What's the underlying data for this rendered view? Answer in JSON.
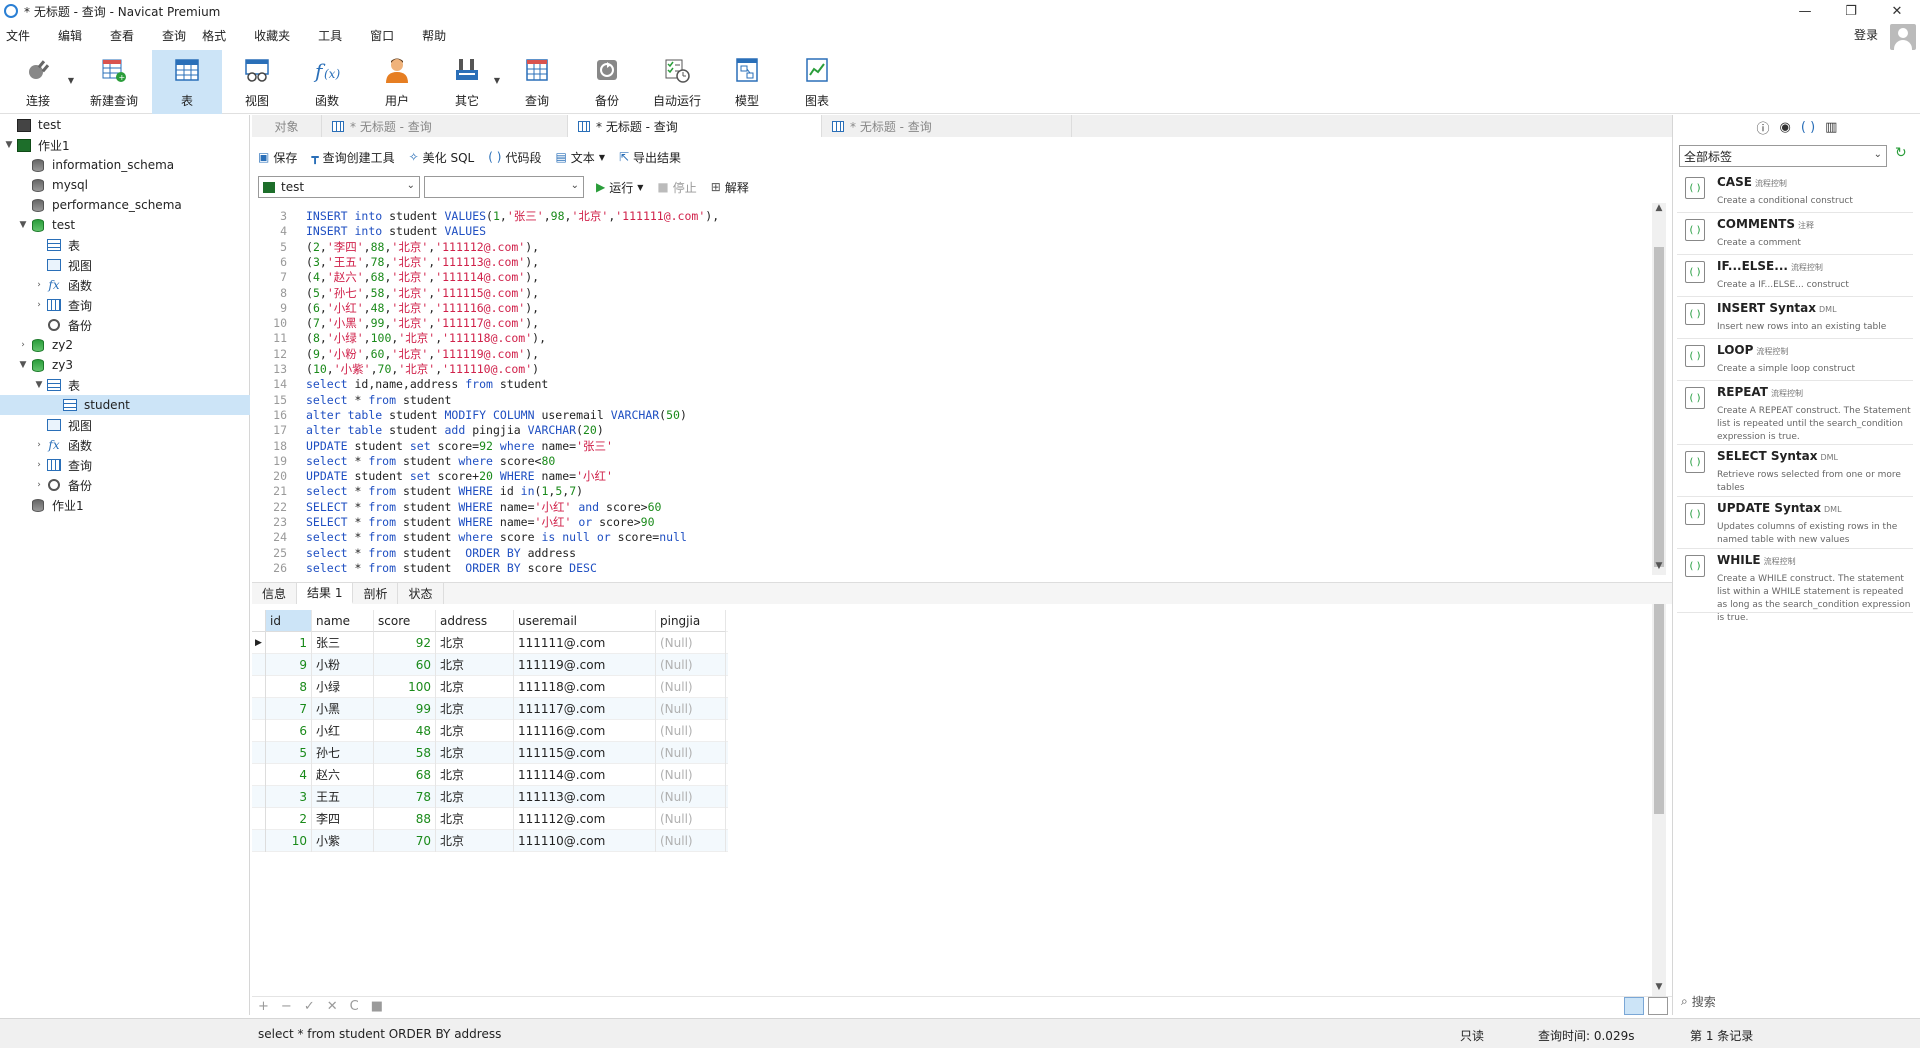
{
  "window": {
    "title": "* 无标题 - 查询 - Navicat Premium",
    "buttons": [
      "—",
      "❐",
      "✕"
    ]
  },
  "menu": {
    "items": [
      "文件",
      "编辑",
      "查看",
      "查询",
      "格式",
      "收藏夹",
      "工具",
      "窗口",
      "帮助"
    ],
    "login": "登录"
  },
  "toolbar": {
    "buttons": [
      {
        "label": "连接",
        "icon": "plug-icon"
      },
      {
        "label": "新建查询",
        "icon": "new-query-icon"
      },
      {
        "label": "表",
        "icon": "table-icon"
      },
      {
        "label": "视图",
        "icon": "view-icon"
      },
      {
        "label": "函数",
        "icon": "function-icon"
      },
      {
        "label": "用户",
        "icon": "user-icon"
      },
      {
        "label": "其它",
        "icon": "tools-icon"
      },
      {
        "label": "查询",
        "icon": "query-icon"
      },
      {
        "label": "备份",
        "icon": "backup-icon"
      },
      {
        "label": "自动运行",
        "icon": "schedule-icon"
      },
      {
        "label": "模型",
        "icon": "model-icon"
      },
      {
        "label": "图表",
        "icon": "chart-icon"
      }
    ]
  },
  "tree": {
    "items": [
      {
        "label": "test"
      },
      {
        "label": "作业1"
      },
      {
        "label": "information_schema"
      },
      {
        "label": "mysql"
      },
      {
        "label": "performance_schema"
      },
      {
        "label": "test"
      },
      {
        "label": "表"
      },
      {
        "label": "视图"
      },
      {
        "label": "函数"
      },
      {
        "label": "查询"
      },
      {
        "label": "备份"
      },
      {
        "label": "zy2"
      },
      {
        "label": "zy3"
      },
      {
        "label": "表"
      },
      {
        "label": "student"
      },
      {
        "label": "视图"
      },
      {
        "label": "函数"
      },
      {
        "label": "查询"
      },
      {
        "label": "备份"
      },
      {
        "label": "作业1"
      }
    ]
  },
  "tabs": [
    {
      "label": "对象"
    },
    {
      "label": "* 无标题 - 查询"
    },
    {
      "label": "* 无标题 - 查询"
    },
    {
      "label": "* 无标题 - 查询"
    }
  ],
  "query_toolbar": {
    "save": "保存",
    "builder": "查询创建工具",
    "beautify": "美化 SQL",
    "snippet": "代码段",
    "text": "文本",
    "export": "导出结果"
  },
  "run_bar": {
    "connection": "test",
    "database": "",
    "run": "运行",
    "stop": "停止",
    "explain": "解释"
  },
  "editor": {
    "lines": [
      {
        "n": "3",
        "t": "INSERT into student VALUES(1,'张三',98,'北京','111111@.com'),"
      },
      {
        "n": "4",
        "t": "INSERT into student VALUES"
      },
      {
        "n": "5",
        "t": "(2,'李四',88,'北京','111112@.com'),"
      },
      {
        "n": "6",
        "t": "(3,'王五',78,'北京','111113@.com'),"
      },
      {
        "n": "7",
        "t": "(4,'赵六',68,'北京','111114@.com'),"
      },
      {
        "n": "8",
        "t": "(5,'孙七',58,'北京','111115@.com'),"
      },
      {
        "n": "9",
        "t": "(6,'小红',48,'北京','111116@.com'),"
      },
      {
        "n": "10",
        "t": "(7,'小黑',99,'北京','111117@.com'),"
      },
      {
        "n": "11",
        "t": "(8,'小绿',100,'北京','111118@.com'),"
      },
      {
        "n": "12",
        "t": "(9,'小粉',60,'北京','111119@.com'),"
      },
      {
        "n": "13",
        "t": "(10,'小紫',70,'北京','111110@.com')"
      },
      {
        "n": "14",
        "t": "select id,name,address from student"
      },
      {
        "n": "15",
        "t": "select * from student"
      },
      {
        "n": "16",
        "t": "alter table student MODIFY COLUMN useremail VARCHAR(50)"
      },
      {
        "n": "17",
        "t": "alter table student add pingjia VARCHAR(20)"
      },
      {
        "n": "18",
        "t": "UPDATE student set score=92 where name='张三'"
      },
      {
        "n": "19",
        "t": "select * from student where score<80"
      },
      {
        "n": "20",
        "t": "UPDATE student set score+20 WHERE name='小红'"
      },
      {
        "n": "21",
        "t": "select * from student WHERE id in(1,5,7)"
      },
      {
        "n": "22",
        "t": "SELECT * from student WHERE name='小红' and score>60"
      },
      {
        "n": "23",
        "t": "SELECT * from student WHERE name='小红' or score>90"
      },
      {
        "n": "24",
        "t": "select * from student where score is null or score=null"
      },
      {
        "n": "25",
        "t": "select * from student  ORDER BY address"
      },
      {
        "n": "26",
        "t": "select * from student  ORDER BY score DESC"
      }
    ]
  },
  "result_tabs": [
    "信息",
    "结果 1",
    "剖析",
    "状态"
  ],
  "grid": {
    "columns": [
      "id",
      "name",
      "score",
      "address",
      "useremail",
      "pingjia"
    ],
    "rows": [
      [
        "1",
        "张三",
        "92",
        "北京",
        "111111@.com",
        "(Null)"
      ],
      [
        "9",
        "小粉",
        "60",
        "北京",
        "111119@.com",
        "(Null)"
      ],
      [
        "8",
        "小绿",
        "100",
        "北京",
        "111118@.com",
        "(Null)"
      ],
      [
        "7",
        "小黑",
        "99",
        "北京",
        "111117@.com",
        "(Null)"
      ],
      [
        "6",
        "小红",
        "48",
        "北京",
        "111116@.com",
        "(Null)"
      ],
      [
        "5",
        "孙七",
        "58",
        "北京",
        "111115@.com",
        "(Null)"
      ],
      [
        "4",
        "赵六",
        "68",
        "北京",
        "111114@.com",
        "(Null)"
      ],
      [
        "3",
        "王五",
        "78",
        "北京",
        "111113@.com",
        "(Null)"
      ],
      [
        "2",
        "李四",
        "88",
        "北京",
        "111112@.com",
        "(Null)"
      ],
      [
        "10",
        "小紫",
        "70",
        "北京",
        "111110@.com",
        "(Null)"
      ]
    ]
  },
  "grid_tools": [
    "+",
    "−",
    "✓",
    "✕",
    "C",
    "■"
  ],
  "status": {
    "sql": "select * from student  ORDER BY address",
    "readonly": "只读",
    "query_time": "查询时间: 0.029s",
    "record": "第 1 条记录"
  },
  "right_panel": {
    "filter": "全部标签",
    "search_placeholder": "搜索",
    "snippets": [
      {
        "name": "CASE",
        "tag": "流程控制",
        "desc": "Create a conditional construct"
      },
      {
        "name": "COMMENTS",
        "tag": "注释",
        "desc": "Create a comment"
      },
      {
        "name": "IF...ELSE...",
        "tag": "流程控制",
        "desc": "Create a IF...ELSE... construct"
      },
      {
        "name": "INSERT Syntax",
        "tag": "DML",
        "desc": "Insert new rows into an existing table"
      },
      {
        "name": "LOOP",
        "tag": "流程控制",
        "desc": "Create a simple loop construct"
      },
      {
        "name": "REPEAT",
        "tag": "流程控制",
        "desc": "Create A REPEAT construct. The Statement list is repeated until the search_condition expression is true."
      },
      {
        "name": "SELECT Syntax",
        "tag": "DML",
        "desc": "Retrieve rows selected from one or more tables"
      },
      {
        "name": "UPDATE Syntax",
        "tag": "DML",
        "desc": "Updates columns of existing rows in the named table with new values"
      },
      {
        "name": "WHILE",
        "tag": "流程控制",
        "desc": "Create a WHILE construct. The statement list within a WHILE statement is repeated as long as the search_condition expression is true."
      }
    ]
  },
  "colors": {
    "accent": "#cce4f7",
    "keyword": "#1f4fc2",
    "string": "#d0214a",
    "number": "#1a8a1a"
  }
}
